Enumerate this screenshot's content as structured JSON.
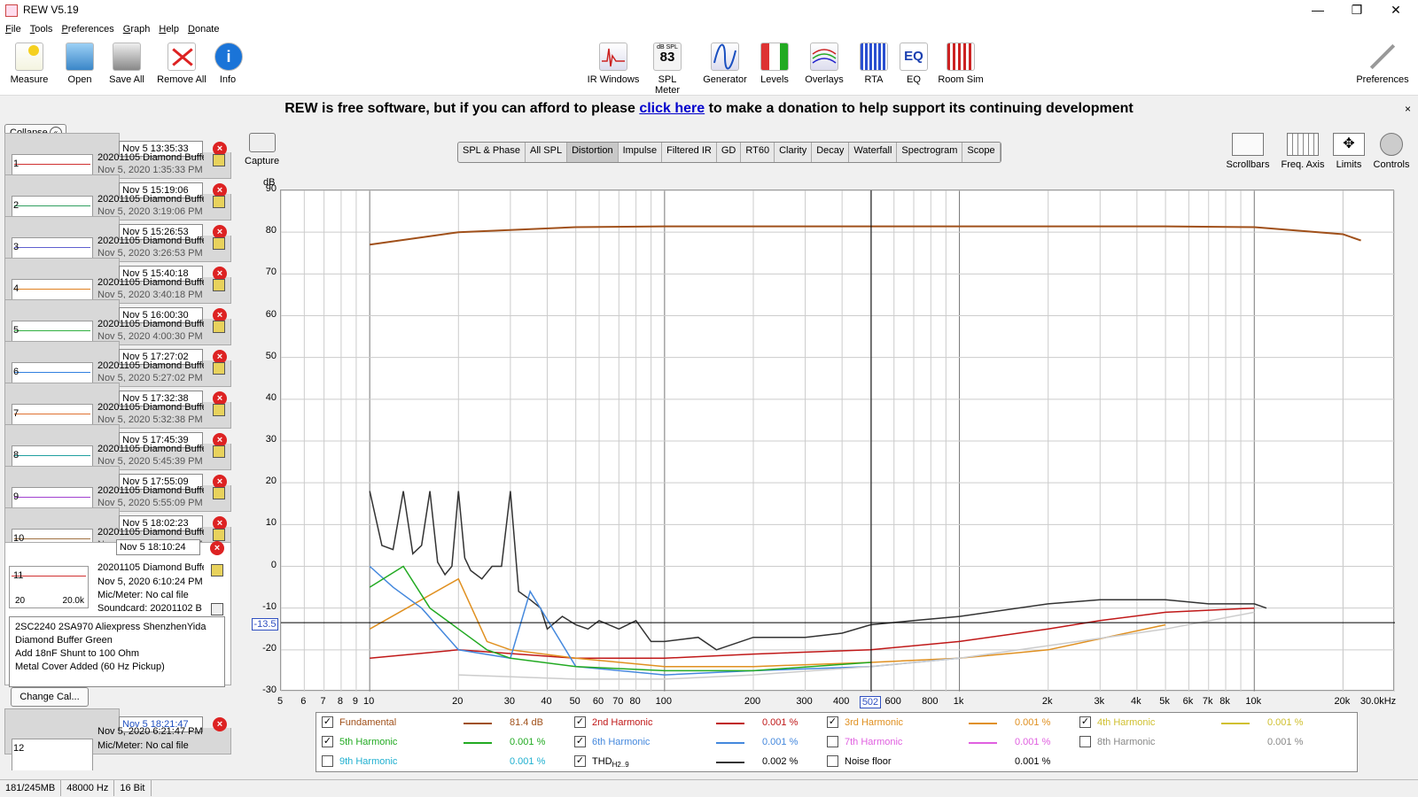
{
  "window": {
    "title": "REW V5.19"
  },
  "menu": [
    "File",
    "Tools",
    "Preferences",
    "Graph",
    "Help",
    "Donate"
  ],
  "toolbar_left": [
    "Measure",
    "Open",
    "Save All",
    "Remove All",
    "Info"
  ],
  "toolbar_center": [
    "IR Windows",
    "SPL Meter",
    "Generator",
    "Levels",
    "Overlays",
    "RTA",
    "EQ",
    "Room Sim"
  ],
  "toolbar_right": {
    "preferences": "Preferences"
  },
  "spl_meter_readout": {
    "unit": "dB SPL",
    "value": "83"
  },
  "banner": {
    "before": "REW is free software, but if you can afford to please",
    "link": "click here",
    "after": "to make a donation to help support its continuing development",
    "close": "×"
  },
  "sidebar": {
    "collapse": "Collapse",
    "measurements": [
      {
        "num": "1",
        "time": "Nov 5 13:35:33",
        "name": "20201105 Diamond Buffer",
        "sub": "Nov 5, 2020 1:35:33 PM",
        "color": "#d03030"
      },
      {
        "num": "2",
        "time": "Nov 5 15:19:06",
        "name": "20201105 Diamond Buffer",
        "sub": "Nov 5, 2020 3:19:06 PM",
        "color": "#30a060"
      },
      {
        "num": "3",
        "time": "Nov 5 15:26:53",
        "name": "20201105 Diamond Buffer",
        "sub": "Nov 5, 2020 3:26:53 PM",
        "color": "#6060d0"
      },
      {
        "num": "4",
        "time": "Nov 5 15:40:18",
        "name": "20201105 Diamond Buffer",
        "sub": "Nov 5, 2020 3:40:18 PM",
        "color": "#e08020"
      },
      {
        "num": "5",
        "time": "Nov 5 16:00:30",
        "name": "20201105 Diamond Buffer",
        "sub": "Nov 5, 2020 4:00:30 PM",
        "color": "#30b040"
      },
      {
        "num": "6",
        "time": "Nov 5 17:27:02",
        "name": "20201105 Diamond Buffer",
        "sub": "Nov 5, 2020 5:27:02 PM",
        "color": "#3080e0"
      },
      {
        "num": "7",
        "time": "Nov 5 17:32:38",
        "name": "20201105 Diamond Buffer",
        "sub": "Nov 5, 2020 5:32:38 PM",
        "color": "#e07030"
      },
      {
        "num": "8",
        "time": "Nov 5 17:45:39",
        "name": "20201105 Diamond Buffer",
        "sub": "Nov 5, 2020 5:45:39 PM",
        "color": "#20a0a0"
      },
      {
        "num": "9",
        "time": "Nov 5 17:55:09",
        "name": "20201105 Diamond Buffer",
        "sub": "Nov 5, 2020 5:55:09 PM",
        "color": "#a040d0"
      },
      {
        "num": "10",
        "time": "Nov 5 18:02:23",
        "name": "20201105 Diamond Buffer",
        "sub": "Nov 5, 2020 6:02:23 PM",
        "color": "#a07040"
      }
    ],
    "active": {
      "num": "11",
      "time": "Nov 5 18:10:24",
      "name": "20201105 Diamond Buffer",
      "date": "Nov 5, 2020 6:10:24 PM",
      "mic": "Mic/Meter: No cal file",
      "soundcard": "Soundcard: 20201102 B",
      "range_lo": "20",
      "range_hi": "20.0k",
      "notes": [
        "2SC2240 2SA970 Aliexpress ShenzhenYida",
        "Diamond Buffer Green",
        "Add 18nF Shunt to 100 Ohm",
        "Metal Cover Added (60 Hz Pickup)"
      ],
      "change_cal": "Change Cal..."
    },
    "next": {
      "num": "12",
      "time": "Nov 5 18:21:47",
      "date": "Nov 5, 2020 6:21:47 PM",
      "mic": "Mic/Meter: No cal file"
    }
  },
  "graph": {
    "capture": "Capture",
    "tabs": [
      "SPL & Phase",
      "All SPL",
      "Distortion",
      "Impulse",
      "Filtered IR",
      "GD",
      "RT60",
      "Clarity",
      "Decay",
      "Waterfall",
      "Spectrogram",
      "Scope"
    ],
    "selected_tab": "Distortion",
    "right_tools": [
      "Scrollbars",
      "Freq. Axis",
      "Limits",
      "Controls"
    ],
    "y_unit": "dB",
    "cursor_y": "-13.5",
    "cursor_x": "502"
  },
  "chart_data": {
    "type": "line",
    "xlabel": "",
    "ylabel": "dB",
    "xscale": "log",
    "xlim": [
      5,
      30000
    ],
    "ylim": [
      -30,
      90
    ],
    "yticks": [
      90,
      80,
      70,
      60,
      50,
      40,
      30,
      20,
      10,
      0,
      -10,
      -20,
      -30
    ],
    "xticks": [
      {
        "v": 5,
        "t": "5"
      },
      {
        "v": 6,
        "t": "6"
      },
      {
        "v": 7,
        "t": "7"
      },
      {
        "v": 8,
        "t": "8"
      },
      {
        "v": 9,
        "t": "9"
      },
      {
        "v": 10,
        "t": "10"
      },
      {
        "v": 20,
        "t": "20"
      },
      {
        "v": 30,
        "t": "30"
      },
      {
        "v": 40,
        "t": "40"
      },
      {
        "v": 50,
        "t": "50"
      },
      {
        "v": 60,
        "t": "60"
      },
      {
        "v": 70,
        "t": "70"
      },
      {
        "v": 80,
        "t": "80"
      },
      {
        "v": 100,
        "t": "100"
      },
      {
        "v": 200,
        "t": "200"
      },
      {
        "v": 300,
        "t": "300"
      },
      {
        "v": 400,
        "t": "400"
      },
      {
        "v": 600,
        "t": "600"
      },
      {
        "v": 800,
        "t": "800"
      },
      {
        "v": 1000,
        "t": "1k"
      },
      {
        "v": 2000,
        "t": "2k"
      },
      {
        "v": 3000,
        "t": "3k"
      },
      {
        "v": 4000,
        "t": "4k"
      },
      {
        "v": 5000,
        "t": "5k"
      },
      {
        "v": 6000,
        "t": "6k"
      },
      {
        "v": 7000,
        "t": "7k"
      },
      {
        "v": 8000,
        "t": "8k"
      },
      {
        "v": 10000,
        "t": "10k"
      },
      {
        "v": 20000,
        "t": "20k"
      },
      {
        "v": 30000,
        "t": "30.0kHz"
      }
    ],
    "cursor": {
      "x": 502,
      "y": -13.5
    },
    "series": [
      {
        "name": "Fundamental",
        "color": "#a0501a",
        "x": [
          10,
          20,
          50,
          100,
          200,
          500,
          1000,
          2000,
          5000,
          10000,
          20000,
          23000
        ],
        "y": [
          77,
          80,
          81.2,
          81.4,
          81.4,
          81.4,
          81.4,
          81.4,
          81.4,
          81.2,
          79.5,
          78
        ]
      },
      {
        "name": "THD",
        "color": "#333333",
        "x": [
          10,
          11,
          12,
          13,
          14,
          15,
          16,
          17,
          18,
          19,
          20,
          21,
          22,
          24,
          26,
          28,
          30,
          32,
          35,
          38,
          40,
          45,
          50,
          55,
          60,
          70,
          80,
          90,
          100,
          130,
          150,
          200,
          300,
          400,
          500,
          700,
          1000,
          2000,
          3000,
          5000,
          7000,
          10000,
          11000
        ],
        "y": [
          18,
          5,
          4,
          18,
          3,
          5,
          18,
          1,
          -2,
          0,
          18,
          2,
          -1,
          -3,
          0,
          0,
          18,
          -6,
          -8,
          -10,
          -15,
          -12,
          -14,
          -15,
          -13,
          -15,
          -13,
          -18,
          -18,
          -17,
          -20,
          -17,
          -17,
          -16,
          -14,
          -13,
          -12,
          -9,
          -8,
          -8,
          -9,
          -9,
          -10
        ]
      },
      {
        "name": "2nd Harmonic",
        "color": "#c01818",
        "x": [
          10,
          20,
          50,
          100,
          200,
          500,
          1000,
          2000,
          3000,
          5000,
          10000
        ],
        "y": [
          -22,
          -20,
          -22,
          -22,
          -21,
          -20,
          -18,
          -15,
          -13,
          -11,
          -10
        ]
      },
      {
        "name": "3rd Harmonic",
        "color": "#e09020",
        "x": [
          10,
          20,
          25,
          30,
          50,
          100,
          200,
          500,
          1000,
          2000,
          5000
        ],
        "y": [
          -15,
          -3,
          -18,
          -20,
          -22,
          -24,
          -24,
          -23,
          -22,
          -20,
          -14
        ]
      },
      {
        "name": "6th Harmonic",
        "color": "#4488dd",
        "x": [
          10,
          12,
          15,
          20,
          30,
          35,
          50,
          100,
          200,
          500,
          1000
        ],
        "y": [
          0,
          -5,
          -10,
          -20,
          -22,
          -6,
          -24,
          -26,
          -25,
          -24,
          -22
        ]
      },
      {
        "name": "5th Harmonic",
        "color": "#22aa22",
        "x": [
          10,
          13,
          16,
          20,
          25,
          30,
          50,
          100,
          200,
          500
        ],
        "y": [
          -5,
          0,
          -10,
          -15,
          -20,
          -22,
          -24,
          -25,
          -25,
          -23
        ]
      },
      {
        "name": "Noise floor",
        "color": "#cccccc",
        "x": [
          20,
          50,
          100,
          200,
          500,
          1000,
          2000,
          5000,
          10000
        ],
        "y": [
          -26,
          -27,
          -27,
          -26,
          -24,
          -22,
          -19,
          -15,
          -11
        ]
      }
    ]
  },
  "legend": [
    {
      "label": "Fundamental",
      "value": "81.4 dB",
      "checked": true,
      "color": "#a0501a",
      "swatch": "#a0501a"
    },
    {
      "label": "2nd Harmonic",
      "value": "0.001 %",
      "checked": true,
      "color": "#c01818",
      "swatch": "#c01818"
    },
    {
      "label": "3rd Harmonic",
      "value": "0.001 %",
      "checked": true,
      "color": "#e09020",
      "swatch": "#e09020"
    },
    {
      "label": "4th Harmonic",
      "value": "0.001 %",
      "checked": true,
      "color": "#d0c030",
      "swatch": "#d0c030"
    },
    {
      "label": "5th Harmonic",
      "value": "0.001 %",
      "checked": true,
      "color": "#22aa22",
      "swatch": "#22aa22"
    },
    {
      "label": "6th Harmonic",
      "value": "0.001 %",
      "checked": true,
      "color": "#4488dd",
      "swatch": "#4488dd"
    },
    {
      "label": "7th Harmonic",
      "value": "0.001 %",
      "checked": false,
      "color": "#e060e0",
      "swatch": "#e060e0"
    },
    {
      "label": "8th Harmonic",
      "value": "0.001 %",
      "checked": false,
      "color": "#888888",
      "swatch": ""
    },
    {
      "label": "9th Harmonic",
      "value": "0.001 %",
      "checked": false,
      "color": "#20b0d0",
      "swatch": ""
    },
    {
      "label": "THD",
      "sub": "H2..9",
      "value": "0.002 %",
      "checked": true,
      "color": "#000000",
      "swatch": "#333333"
    },
    {
      "label": "Noise floor",
      "value": "0.001 %",
      "checked": false,
      "color": "#000000",
      "swatch": ""
    }
  ],
  "status": [
    "181/245MB",
    "48000 Hz",
    "16 Bit"
  ]
}
